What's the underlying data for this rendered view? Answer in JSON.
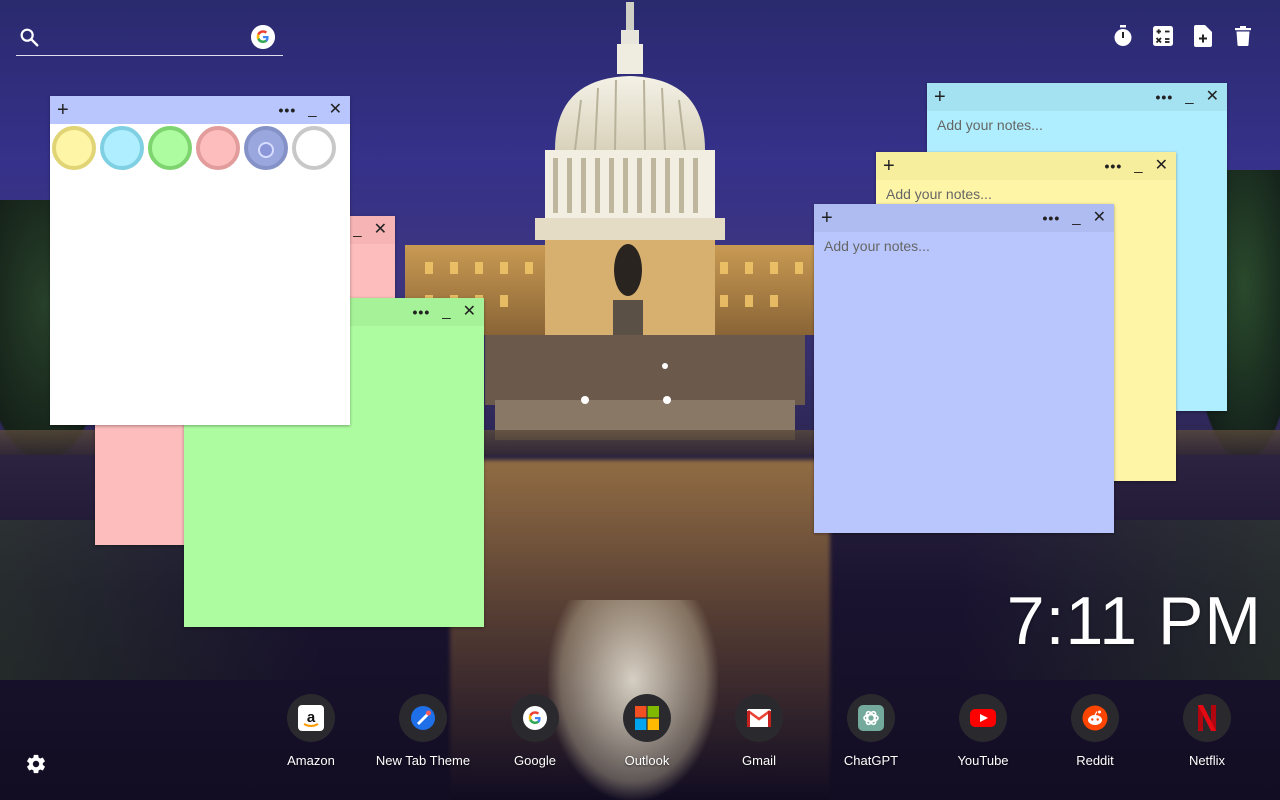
{
  "search": {
    "placeholder": ""
  },
  "toolbar": {
    "items": [
      {
        "icon": "timer-icon"
      },
      {
        "icon": "calculator-icon"
      },
      {
        "icon": "new-note-icon"
      },
      {
        "icon": "trash-icon"
      }
    ]
  },
  "notes": {
    "plus": "+",
    "dots": "•••",
    "minimize": "_",
    "close": "✕",
    "placeholder": "Add your notes...",
    "palette": [
      {
        "name": "yellow",
        "fill": "#fef5a7",
        "ring": "#e0d474"
      },
      {
        "name": "cyan",
        "fill": "#aeeefe",
        "ring": "#7fd0e2"
      },
      {
        "name": "green",
        "fill": "#adfda0",
        "ring": "#7ed46f"
      },
      {
        "name": "pink",
        "fill": "#fdbdbd",
        "ring": "#e39c9c"
      },
      {
        "name": "blue",
        "fill": "#b8c6fd",
        "ring": "#8592c8"
      },
      {
        "name": "white",
        "fill": "#ffffff",
        "ring": "#c8c8c8"
      }
    ]
  },
  "clock": {
    "time": "7:11 PM"
  },
  "dock": {
    "apps": [
      {
        "label": "Amazon",
        "icon": "amazon-icon"
      },
      {
        "label": "New Tab Theme",
        "icon": "newtab-theme-icon"
      },
      {
        "label": "Google",
        "icon": "google-icon"
      },
      {
        "label": "Outlook",
        "icon": "outlook-icon"
      },
      {
        "label": "Gmail",
        "icon": "gmail-icon"
      },
      {
        "label": "ChatGPT",
        "icon": "chatgpt-icon"
      },
      {
        "label": "YouTube",
        "icon": "youtube-icon"
      },
      {
        "label": "Reddit",
        "icon": "reddit-icon"
      },
      {
        "label": "Netflix",
        "icon": "netflix-icon"
      }
    ]
  },
  "colors": {
    "accent_blue": "#b8c6fd",
    "note_yellow": "#fef5a7",
    "note_cyan": "#aeeefe",
    "note_green": "#adfda0",
    "note_pink": "#fdbdbd"
  }
}
